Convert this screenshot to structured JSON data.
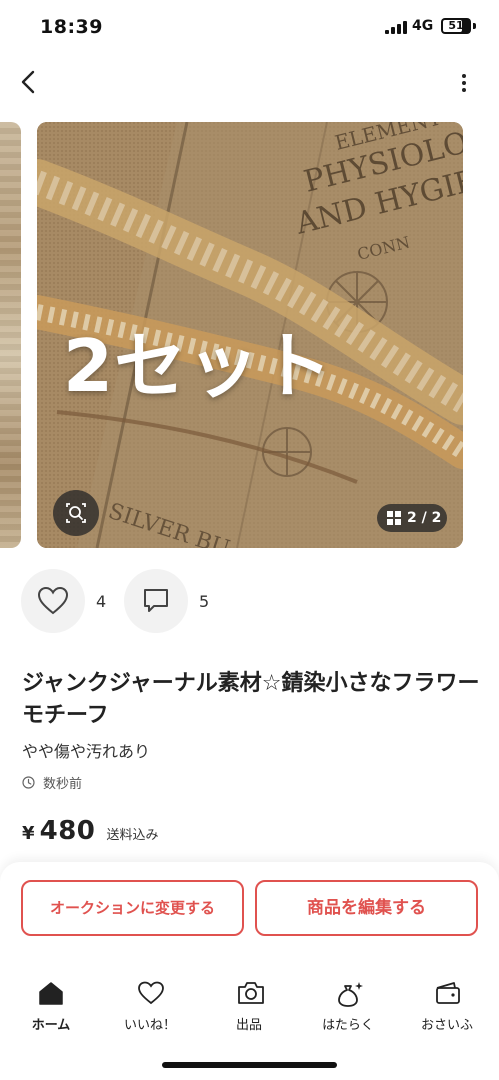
{
  "status_bar": {
    "time": "18:39",
    "network": "4G",
    "battery": "51"
  },
  "gallery": {
    "overlay_text": "2セット",
    "page_indicator": "2 / 2",
    "cover_text_1": "ELEMENT",
    "cover_text_2": "PHYSIOLO",
    "cover_text_3": "AND HYGIE",
    "cover_text_4": "CONN",
    "cover_text_5": "SILVER BU"
  },
  "actions": {
    "likes_count": "4",
    "comments_count": "5"
  },
  "item": {
    "title": "ジャンクジャーナル素材☆錆染小さなフラワーモチーフ",
    "condition": "やや傷や汚れあり",
    "posted": "数秒前",
    "price_symbol": "¥",
    "price": "480",
    "price_note": "送料込み"
  },
  "buttons": {
    "auction": "オークションに変更する",
    "edit": "商品を編集する"
  },
  "accent_color": "#e0524f",
  "tabs": [
    {
      "label": "ホーム",
      "icon": "home-icon"
    },
    {
      "label": "いいね！",
      "icon": "heart-icon"
    },
    {
      "label": "出品",
      "icon": "camera-icon"
    },
    {
      "label": "はたらく",
      "icon": "bag-sparkle-icon"
    },
    {
      "label": "おさいふ",
      "icon": "wallet-icon"
    }
  ]
}
